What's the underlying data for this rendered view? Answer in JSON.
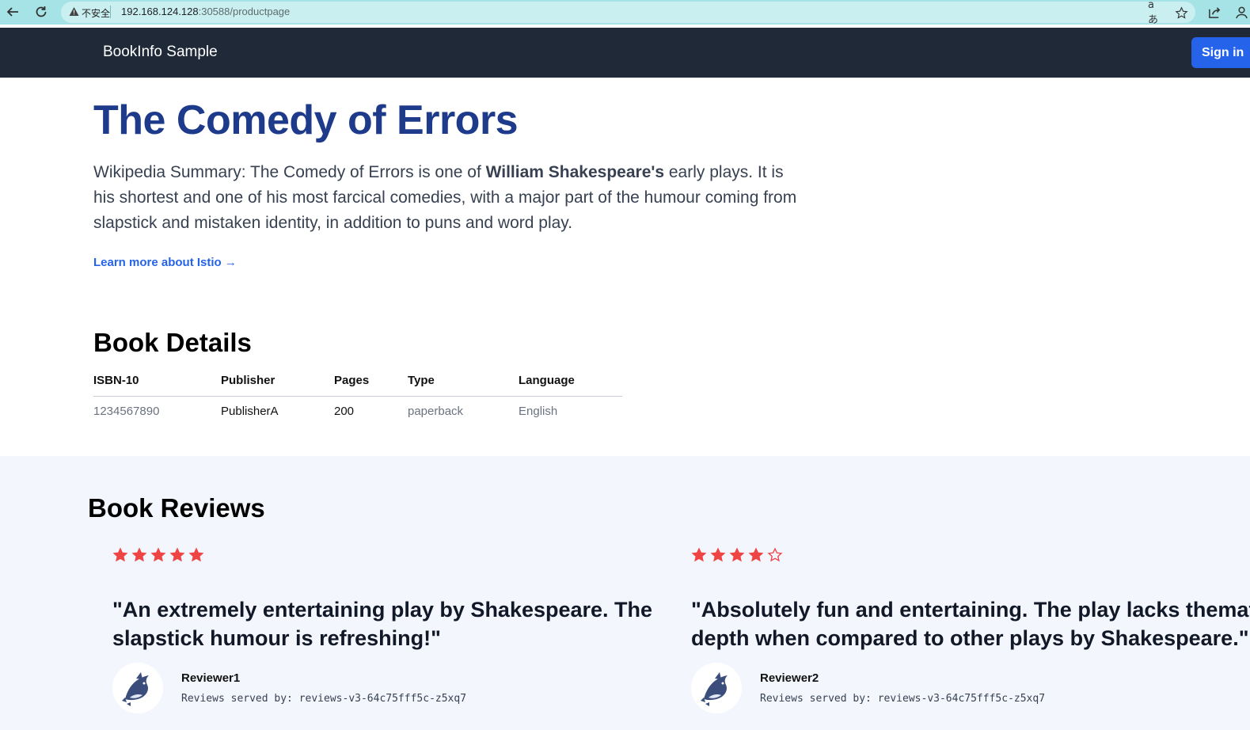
{
  "browser": {
    "insecure_label": "不安全",
    "url_host": "192.168.124.128",
    "url_rest": ":30588/productpage",
    "translate_label": "aあ"
  },
  "header": {
    "brand": "BookInfo Sample",
    "signin_label": "Sign in"
  },
  "product": {
    "title": "The Comedy of Errors",
    "summary_prefix": "Wikipedia Summary: The Comedy of Errors is one of ",
    "summary_bold": "William Shakespeare's",
    "summary_suffix": " early plays. It is his shortest and one of his most farcical comedies, with a major part of the humour coming from slapstick and mistaken identity, in addition to puns and word play.",
    "learn_more": "Learn more about Istio →"
  },
  "details": {
    "heading": "Book Details",
    "columns": [
      "ISBN-10",
      "Publisher",
      "Pages",
      "Type",
      "Language"
    ],
    "row": [
      "1234567890",
      "PublisherA",
      "200",
      "paperback",
      "English"
    ]
  },
  "reviews": {
    "heading": "Book Reviews",
    "star_color": "#ef4444",
    "items": [
      {
        "rating": 5,
        "max_rating": 5,
        "text": "\"An extremely entertaining play by Shakespeare. The slapstick humour is refreshing!\"",
        "line1": "\"An extremely entertaining play by Shakespeare. The",
        "line2": "slapstick humour is refreshing!\"",
        "reviewer": "Reviewer1",
        "served_by": "Reviews served by: reviews-v3-64c75fff5c-z5xq7",
        "avatar_icon": "dolphin-avatar-icon"
      },
      {
        "rating": 4,
        "max_rating": 5,
        "text": "\"Absolutely fun and entertaining. The play lacks thematic depth when compared to other plays by Shakespeare.\"",
        "line1": "\"Absolutely fun and entertaining. The play lacks thematic",
        "line2": "depth when compared to other plays by Shakespeare.\"",
        "reviewer": "Reviewer2",
        "served_by": "Reviews served by: reviews-v3-64c75fff5c-z5xq7",
        "avatar_icon": "dolphin-avatar-icon"
      }
    ]
  },
  "colors": {
    "header_bg": "#1f2937",
    "title": "#1e3a8a",
    "link": "#2563eb",
    "reviews_bg": "#f3f6fd"
  }
}
